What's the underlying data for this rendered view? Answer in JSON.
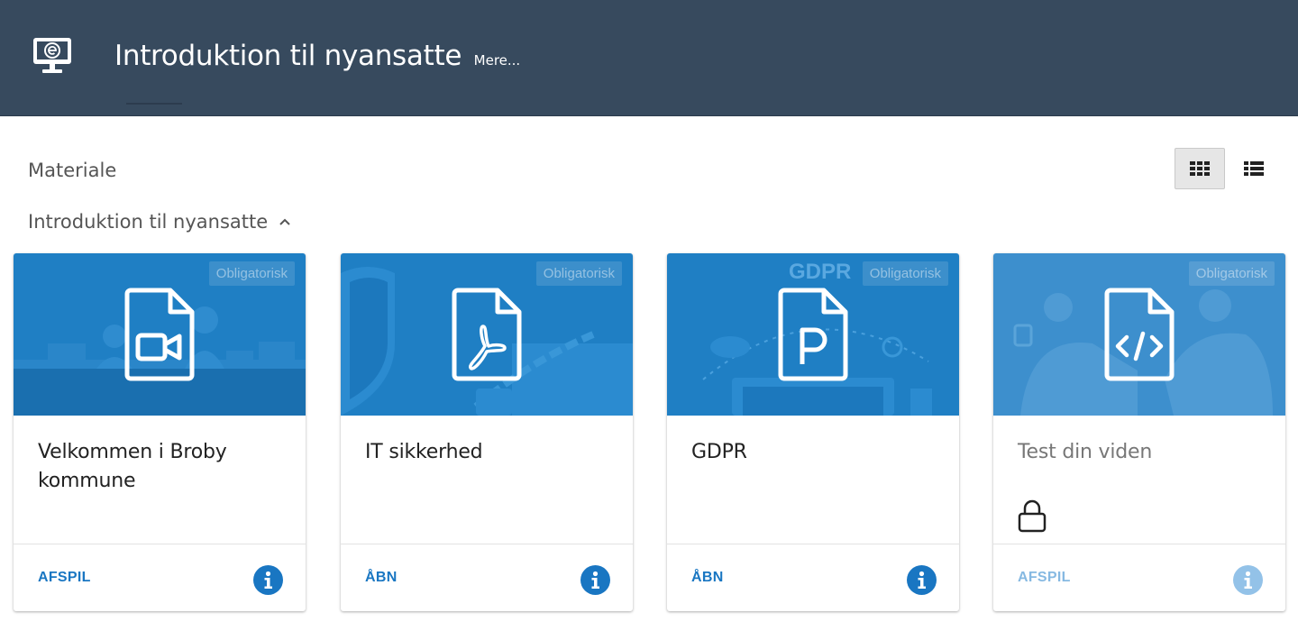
{
  "header": {
    "title": "Introduktion til nyansatte",
    "more_label": "Mere...",
    "logo_icon": "monitor-e-icon"
  },
  "section": {
    "title": "Materiale"
  },
  "view_toggle": {
    "active": "grid",
    "grid_icon": "grid-view-icon",
    "list_icon": "list-view-icon"
  },
  "group": {
    "title": "Introduktion til nyansatte",
    "expanded": true,
    "toggle_icon": "chevron-up-icon"
  },
  "cards": [
    {
      "title": "Velkommen i Broby kommune",
      "badge": "Obligatorisk",
      "file_icon": "video-file-icon",
      "action": "AFSPIL",
      "locked": false
    },
    {
      "title": "IT sikkerhed",
      "badge": "Obligatorisk",
      "file_icon": "pdf-file-icon",
      "action": "ÅBN",
      "locked": false
    },
    {
      "title": "GDPR",
      "badge": "Obligatorisk",
      "file_icon": "powerpoint-file-icon",
      "action": "ÅBN",
      "locked": false,
      "image_text": "GDPR"
    },
    {
      "title": "Test din viden",
      "badge": "Obligatorisk",
      "file_icon": "code-file-icon",
      "action": "AFSPIL",
      "locked": true
    }
  ],
  "colors": {
    "header_bg": "#374a5e",
    "card_image_bg": "#1f7fc4",
    "accent": "#1976c2"
  }
}
